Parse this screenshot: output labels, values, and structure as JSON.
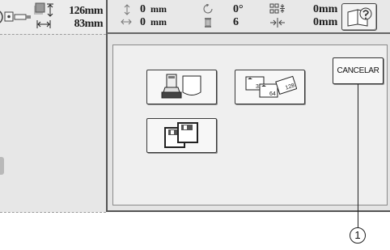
{
  "preview": {
    "width_value": "126mm",
    "height_value": "83mm"
  },
  "header": {
    "vertical_offset": {
      "value": "0",
      "unit": "mm"
    },
    "horizontal_offset": {
      "value": "0",
      "unit": "mm"
    },
    "rotation": {
      "value": "0°"
    },
    "color_count": {
      "value": "6"
    },
    "spacing_vertical": {
      "value": "0mm"
    },
    "spacing_horizontal": {
      "value": "0mm"
    }
  },
  "dialog": {
    "cancel_label": "CANCELAR",
    "format_icon_sizes": [
      "32",
      "64",
      "128"
    ]
  },
  "callout": {
    "label": "1"
  }
}
